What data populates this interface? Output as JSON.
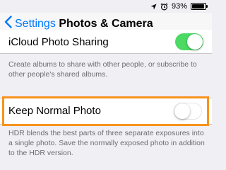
{
  "status_bar": {
    "battery_percent_label": "93%",
    "battery_level": 0.93
  },
  "navbar": {
    "back_label": "Settings",
    "title": "Photos & Camera"
  },
  "icloud_sharing": {
    "label": "iCloud Photo Sharing",
    "enabled": true,
    "footer": "Create albums to share with other people, or subscribe to other people's shared albums."
  },
  "keep_normal_photo": {
    "label": "Keep Normal Photo",
    "enabled": false,
    "footer": "HDR blends the best parts of three separate exposures into a single photo. Save the normally exposed photo in addition to the HDR version."
  },
  "colors": {
    "accent": "#007aff",
    "toggle_on": "#4cd964",
    "highlight": "#f7941d",
    "background": "#efeff4"
  }
}
